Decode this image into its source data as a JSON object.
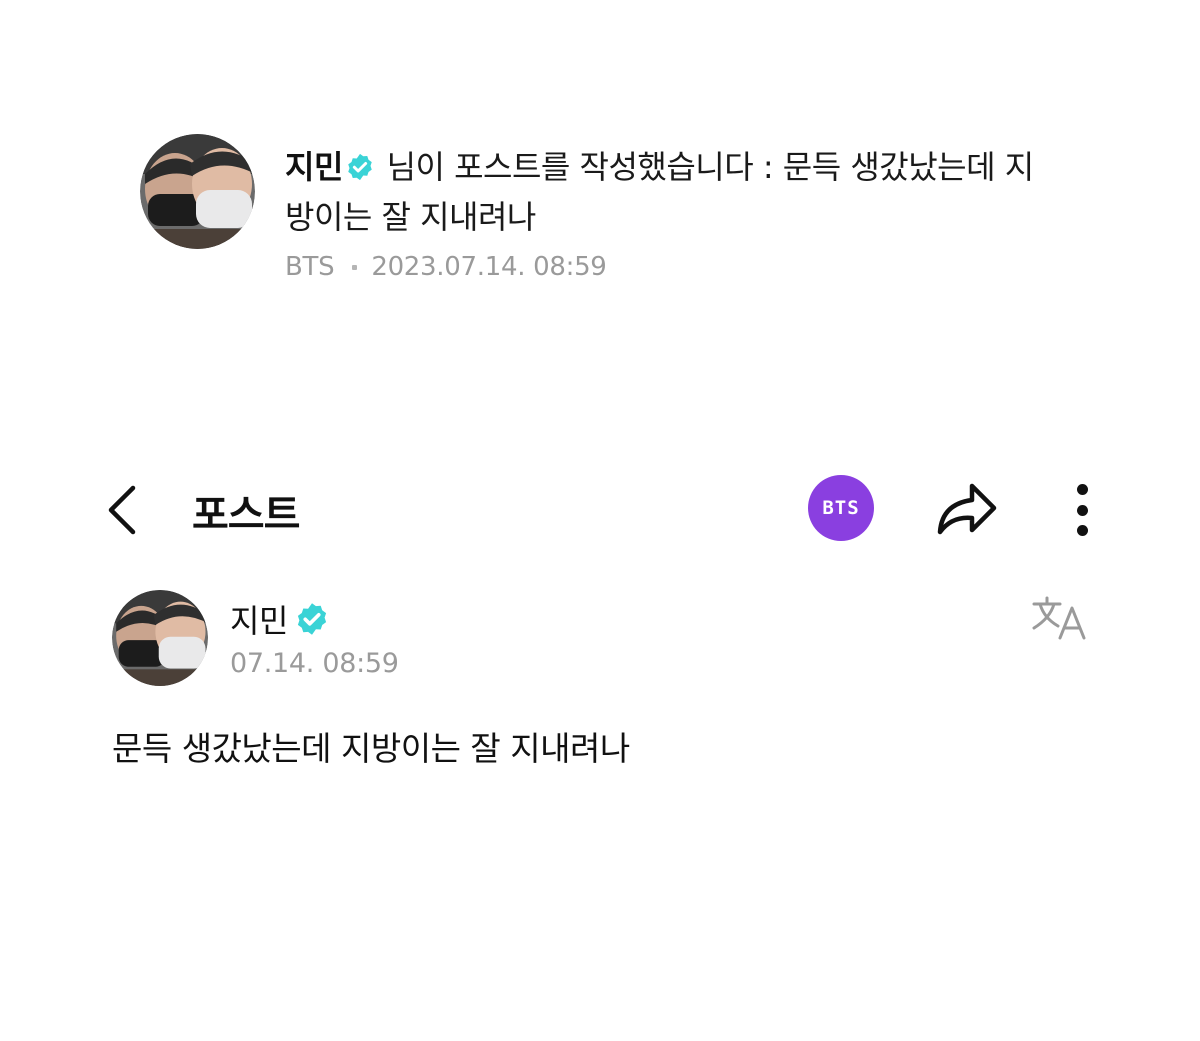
{
  "notification": {
    "author": "지민",
    "verified_icon": "verified-badge-icon",
    "message": " 님이 포스트를 작성했습니다 : 문득 생갔났는데 지방이는 잘 지내려나",
    "community": "BTS",
    "timestamp": "2023.07.14. 08:59"
  },
  "header": {
    "back_icon": "chevron-left-icon",
    "title": "포스트",
    "community_badge": "BTS",
    "share_icon": "share-arrow-icon",
    "more_icon": "more-vertical-icon"
  },
  "post": {
    "author": "지민",
    "time": "07.14. 08:59",
    "translate_icon": "translate-icon",
    "body": "문득 생갔났는데 지방이는 잘 지내려나"
  },
  "colors": {
    "verified": "#3ad3d6",
    "community_badge": "#8a3fe0",
    "meta_text": "#9a9a9a"
  }
}
